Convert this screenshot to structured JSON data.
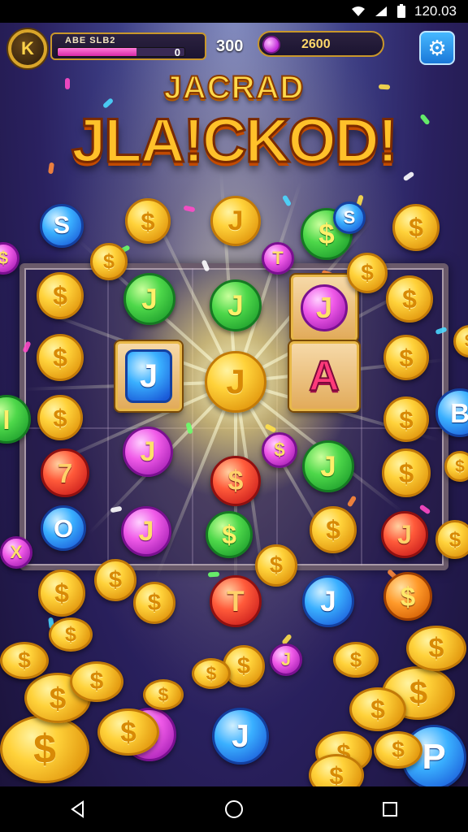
{
  "status_bar": {
    "time": "120.03",
    "icons": [
      "wifi-icon",
      "signal-icon",
      "battery-icon"
    ]
  },
  "hud": {
    "avatar_letter": "K",
    "player_label": "ABE SLB2",
    "xp_progress": 0.62,
    "xp_value": "0",
    "coin_count": "300",
    "gem_count": "2600",
    "settings_icon": "gear-icon"
  },
  "title": {
    "line1": "JACRAD",
    "line2": "JLA!CKOD!"
  },
  "colors": {
    "gold": "#ffd23a",
    "accent_pink": "#f05ae8",
    "frame": "#6a5a6a"
  },
  "board": {
    "coins": [
      {
        "type": "blue",
        "symbol": "S"
      },
      {
        "type": "gold",
        "symbol": "$"
      },
      {
        "type": "gold",
        "symbol": "J"
      },
      {
        "type": "green",
        "symbol": "$"
      },
      {
        "type": "blue",
        "symbol": "S"
      },
      {
        "type": "gold",
        "symbol": "$"
      },
      {
        "type": "pink",
        "symbol": "$"
      },
      {
        "type": "gold",
        "symbol": "$"
      },
      {
        "type": "gold",
        "symbol": "$"
      },
      {
        "type": "gold",
        "symbol": "$"
      },
      {
        "type": "green",
        "symbol": "J"
      },
      {
        "type": "green",
        "symbol": "J"
      },
      {
        "type": "pink",
        "symbol": "T"
      },
      {
        "type": "gold",
        "symbol": "$"
      },
      {
        "type": "gold",
        "symbol": "$"
      },
      {
        "type": "gold",
        "symbol": "J"
      },
      {
        "type": "gold",
        "symbol": "$"
      },
      {
        "type": "gold",
        "symbol": "$"
      },
      {
        "type": "green",
        "symbol": "I"
      },
      {
        "type": "gold",
        "symbol": "$"
      },
      {
        "type": "gold",
        "symbol": "$"
      },
      {
        "type": "blue",
        "symbol": "B"
      },
      {
        "type": "red",
        "symbol": "7"
      },
      {
        "type": "pink",
        "symbol": "J"
      },
      {
        "type": "pink",
        "symbol": "$"
      },
      {
        "type": "red",
        "symbol": "$"
      },
      {
        "type": "green",
        "symbol": "J"
      },
      {
        "type": "gold",
        "symbol": "$"
      },
      {
        "type": "gold",
        "symbol": "$"
      },
      {
        "type": "blue",
        "symbol": "O"
      },
      {
        "type": "pink",
        "symbol": "J"
      },
      {
        "type": "green",
        "symbol": "$"
      },
      {
        "type": "gold",
        "symbol": "$"
      },
      {
        "type": "red",
        "symbol": "J"
      },
      {
        "type": "pink",
        "symbol": "X"
      },
      {
        "type": "gold",
        "symbol": "$"
      },
      {
        "type": "gold",
        "symbol": "$"
      },
      {
        "type": "gold",
        "symbol": "$"
      },
      {
        "type": "red",
        "symbol": "T"
      },
      {
        "type": "blue",
        "symbol": "J"
      },
      {
        "type": "orange",
        "symbol": "$"
      },
      {
        "type": "gold",
        "symbol": "$"
      },
      {
        "type": "gold",
        "symbol": "$"
      },
      {
        "type": "pink",
        "symbol": "$"
      },
      {
        "type": "pink",
        "symbol": "J"
      },
      {
        "type": "blue",
        "symbol": "J"
      },
      {
        "type": "gold",
        "symbol": "$"
      },
      {
        "type": "blue",
        "symbol": "P"
      }
    ],
    "tiles": [
      {
        "type": "blue",
        "symbol": "J"
      },
      {
        "type": "pink",
        "symbol": "J"
      },
      {
        "letter": "A"
      }
    ]
  },
  "nav": {
    "back": "back-icon",
    "home": "home-icon",
    "recents": "recents-icon"
  }
}
